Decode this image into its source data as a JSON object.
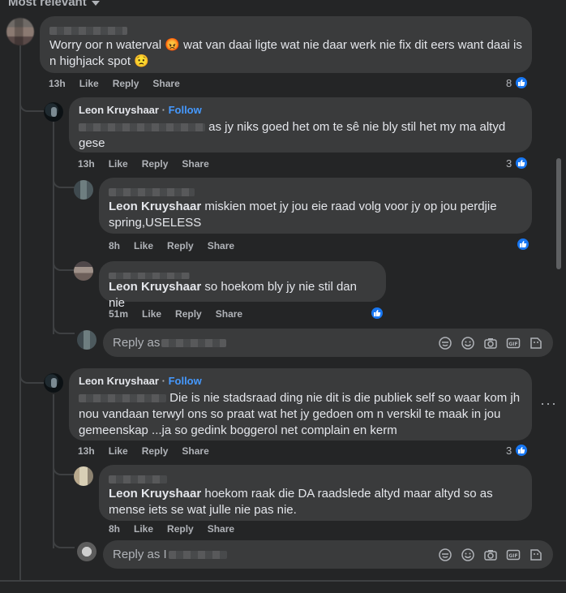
{
  "header": {
    "sort_label": "Most relevant"
  },
  "comments": {
    "c1": {
      "text": "Worry oor n waterval 😡 wat van daai ligte wat nie daar werk nie fix dit eers want daai is n highjack spot 😟",
      "time": "13h",
      "like": "Like",
      "reply": "Reply",
      "share": "Share",
      "reactions": "8"
    },
    "r1": {
      "name": "Leon Kruyshaar",
      "follow": "Follow",
      "text": "as jy niks goed het om te sê nie bly stil het my ma altyd gese",
      "time": "13h",
      "like": "Like",
      "reply": "Reply",
      "share": "Share",
      "reactions": "3"
    },
    "r2": {
      "mention": "Leon Kruyshaar",
      "text": "miskien moet jy jou eie raad volg voor jy op jou perdjie spring,USELESS",
      "time": "8h",
      "like": "Like",
      "reply": "Reply",
      "share": "Share"
    },
    "r3": {
      "mention": "Leon Kruyshaar",
      "text": "so hoekom bly jy nie stil dan nie",
      "time": "51m",
      "like": "Like",
      "reply": "Reply",
      "share": "Share"
    },
    "reply_box1": {
      "placeholder": "Reply as"
    },
    "r4": {
      "name": "Leon Kruyshaar",
      "follow": "Follow",
      "text": "Die is nie stadsraad ding nie dit is die publiek self so waar kom jh nou vandaan terwyl ons so praat wat het jy gedoen om n verskil te maak in jou gemeenskap ...ja so gedink boggerol net complain en kerm",
      "time": "13h",
      "like": "Like",
      "reply": "Reply",
      "share": "Share",
      "reactions": "3"
    },
    "r5": {
      "mention": "Leon Kruyshaar",
      "text": "hoekom raak die DA raadslede altyd maar altyd so as mense iets se wat julle nie pas nie.",
      "time": "8h",
      "like": "Like",
      "reply": "Reply",
      "share": "Share"
    },
    "reply_box2": {
      "placeholder": "Reply as I"
    }
  },
  "more_label": "···",
  "colors": {
    "accent": "#4599ff",
    "like_blue": "#1877f2",
    "bubble": "#3a3b3c",
    "background": "#242526"
  }
}
